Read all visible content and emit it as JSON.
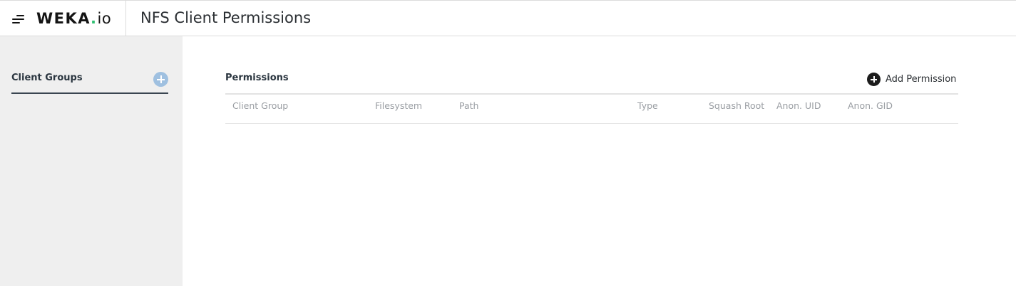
{
  "header": {
    "logo_text_main": "WEKA",
    "logo_text_dot": ".",
    "logo_text_io": "io",
    "page_title": "NFS Client Permissions"
  },
  "sidebar": {
    "title": "Client Groups"
  },
  "main": {
    "section_title": "Permissions",
    "add_button_label": "Add Permission",
    "columns": [
      "Client Group",
      "Filesystem",
      "Path",
      "Type",
      "Squash Root",
      "Anon. UID",
      "Anon. GID"
    ]
  },
  "icons": {
    "menu": "hamburger-menu-icon",
    "sidebar_add": "plus-circle-icon",
    "add_permission": "plus-circle-icon"
  },
  "colors": {
    "sidebar_bg": "#efefef",
    "sidebar_add_icon": "#9fc0e0",
    "logo_accent": "#2fbf71",
    "add_permission_icon": "#1c1c1c",
    "column_header_text": "#9a9ea3"
  }
}
